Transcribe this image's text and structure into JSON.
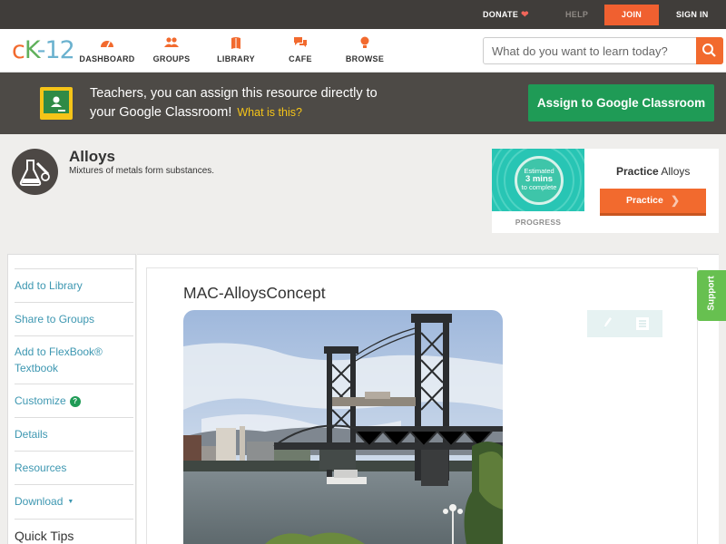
{
  "topbar": {
    "donate": "DONATE",
    "help": "HELP",
    "join": "JOIN",
    "sign_in": "SIGN IN"
  },
  "nav": {
    "logo": {
      "c": "c",
      "k": "K",
      "n": "-12"
    },
    "items": [
      {
        "label": "DASHBOARD",
        "icon": "dashboard-icon"
      },
      {
        "label": "GROUPS",
        "icon": "groups-icon"
      },
      {
        "label": "LIBRARY",
        "icon": "library-icon"
      },
      {
        "label": "CAFE",
        "icon": "cafe-icon"
      },
      {
        "label": "BROWSE",
        "icon": "browse-icon"
      }
    ],
    "search_placeholder": "What do you want to learn today?"
  },
  "banner": {
    "line1": "Teachers, you can assign this resource directly to",
    "line2": "your Google Classroom!",
    "what_is_this": "What is this?",
    "assign_button": "Assign to Google Classroom"
  },
  "concept": {
    "title": "Alloys",
    "description": "Mixtures of metals form substances.",
    "icon": "chemistry-flask-icon"
  },
  "practice": {
    "estimated": "Estimated",
    "mins": "3 mins",
    "to_complete": "to complete",
    "progress_label": "PROGRESS",
    "title_bold": "Practice",
    "title_rest": "Alloys",
    "button": "Practice"
  },
  "sidebar": {
    "items": [
      "Add to Library",
      "Share to Groups",
      "Add to FlexBook® Textbook",
      "Customize",
      "Details",
      "Resources",
      "Download"
    ],
    "add_flexbook_line1": "Add to FlexBook®",
    "add_flexbook_line2": "Textbook",
    "help_glyph": "?",
    "quick_tips": "Quick Tips"
  },
  "content": {
    "modality_title": "MAC-AlloysConcept",
    "image_subject": "lift bridge over river"
  },
  "support": "Support",
  "colors": {
    "orange": "#f26a2e",
    "green": "#1f9b56",
    "teal_link": "#3d97b1",
    "dark_bar": "#403d3a",
    "banner": "#4d4a46"
  }
}
